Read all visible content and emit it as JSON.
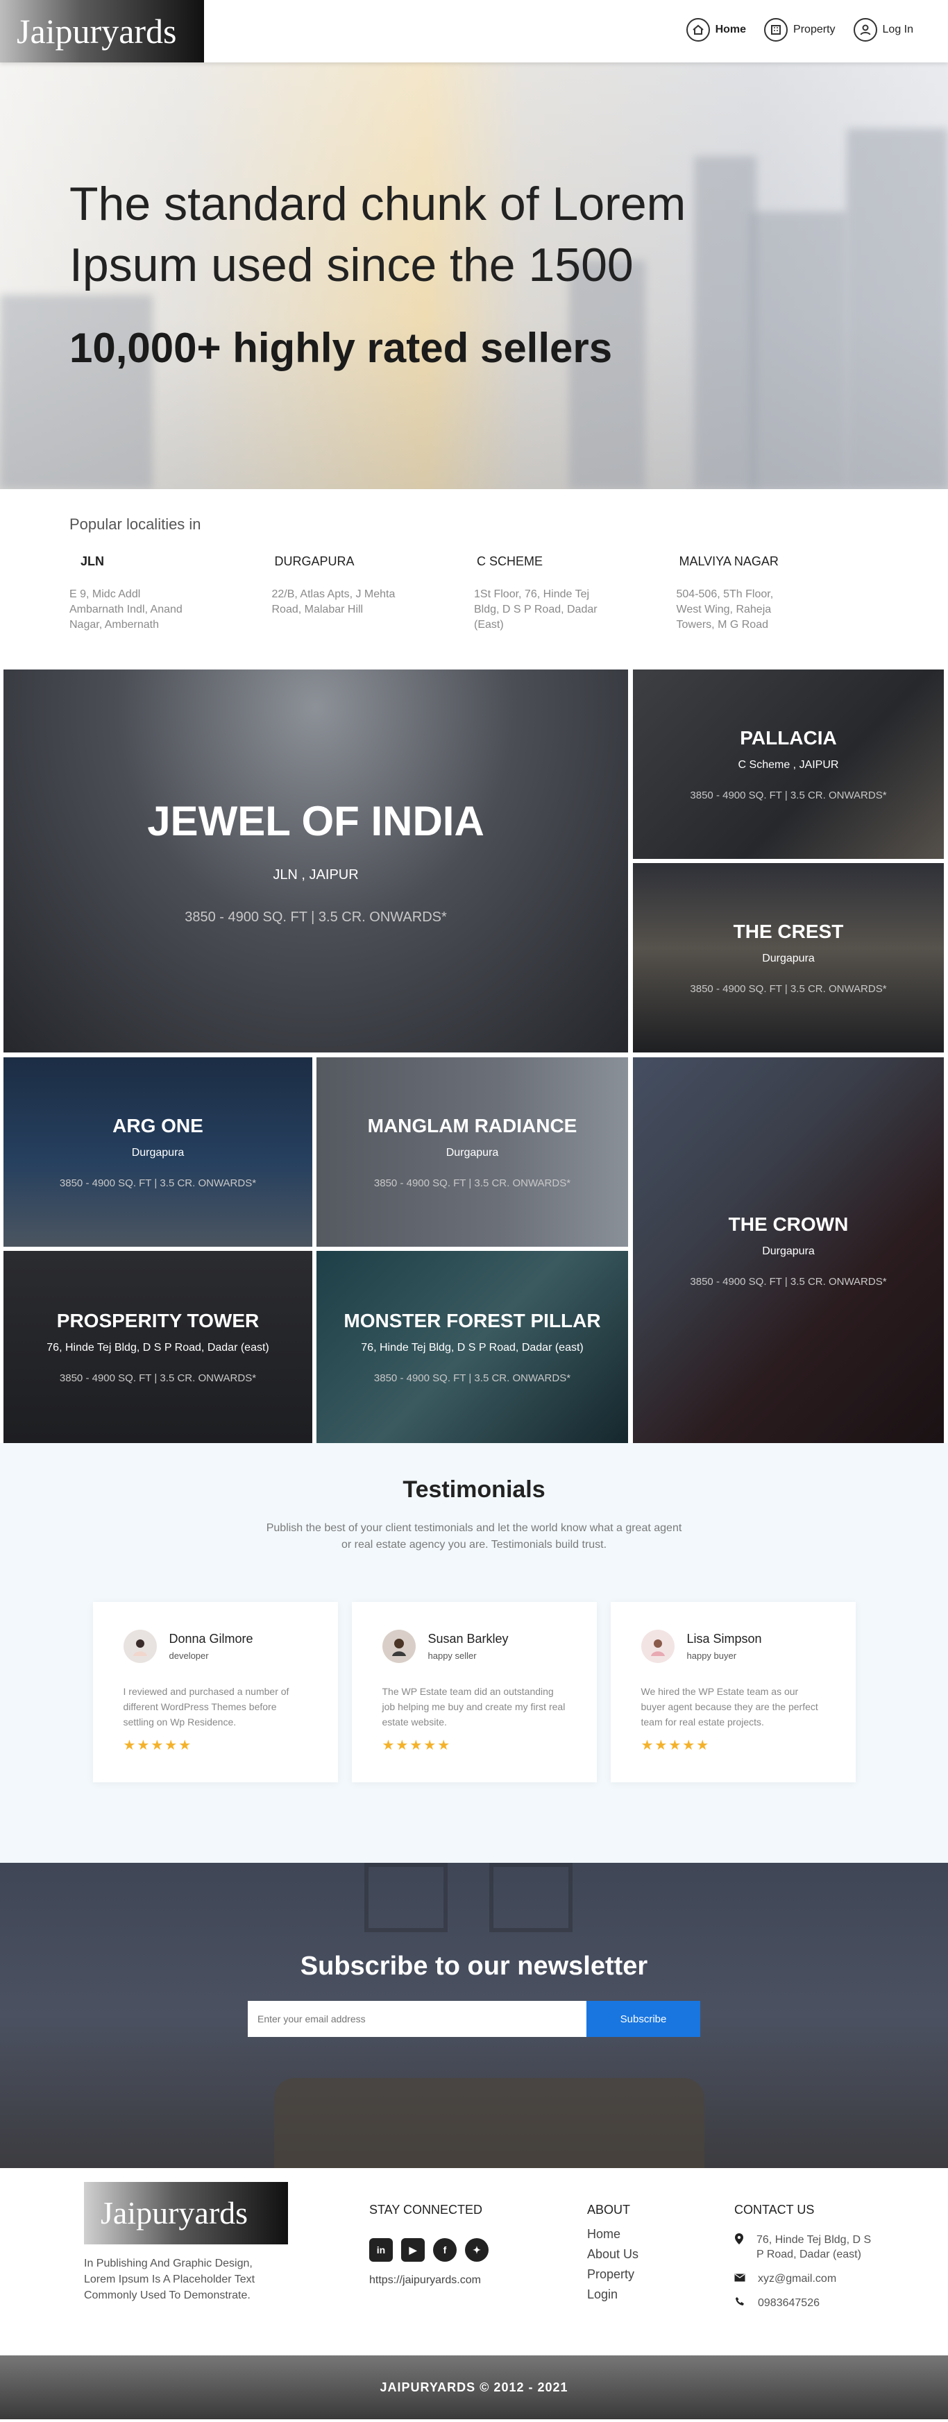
{
  "header": {
    "logo": "Jaipuryards",
    "nav": [
      {
        "label": "Home",
        "icon": "home-icon"
      },
      {
        "label": "Property",
        "icon": "building-icon"
      },
      {
        "label": "Log In",
        "icon": "user-icon"
      }
    ]
  },
  "hero": {
    "title": "The standard chunk of Lorem Ipsum used since the 1500",
    "subtitle": "10,000+ highly rated sellers"
  },
  "localities": {
    "heading": "Popular localities in",
    "items": [
      {
        "name": "JLN",
        "address": "E 9, Midc Addl Ambarnath Indl, Anand Nagar, Ambernath"
      },
      {
        "name": "DURGAPURA",
        "address": "22/B, Atlas Apts, J Mehta Road, Malabar Hill"
      },
      {
        "name": "C SCHEME",
        "address": "1St Floor, 76, Hinde Tej Bldg, D S P Road, Dadar (East)"
      },
      {
        "name": "MALVIYA NAGAR",
        "address": "504-506, 5Th Floor, West Wing, Raheja Towers, M G Road"
      }
    ]
  },
  "properties": [
    {
      "name": "JEWEL OF INDIA",
      "location": "JLN , JAIPUR",
      "area": "3850 - 4900 SQ. FT | 3.5 CR. ONWARDS*"
    },
    {
      "name": "PALLACIA",
      "location": "C Scheme , JAIPUR",
      "area": "3850 - 4900 SQ. FT | 3.5 CR. ONWARDS*"
    },
    {
      "name": "THE CREST",
      "location": "Durgapura",
      "area": "3850 - 4900 SQ. FT | 3.5 CR. ONWARDS*"
    },
    {
      "name": "ARG ONE",
      "location": "Durgapura",
      "area": "3850 - 4900 SQ. FT | 3.5 CR. ONWARDS*"
    },
    {
      "name": "MANGLAM RADIANCE",
      "location": "Durgapura",
      "area": "3850 - 4900 SQ. FT | 3.5 CR. ONWARDS*"
    },
    {
      "name": "THE CROWN",
      "location": "Durgapura",
      "area": "3850 - 4900 SQ. FT | 3.5 CR. ONWARDS*"
    },
    {
      "name": "PROSPERITY TOWER",
      "location": "76, Hinde Tej Bldg, D S P Road, Dadar (east)",
      "area": "3850 - 4900 SQ. FT | 3.5 CR. ONWARDS*"
    },
    {
      "name": "MONSTER FOREST PILLAR",
      "location": "76, Hinde Tej Bldg, D S P Road, Dadar (east)",
      "area": "3850 - 4900 SQ. FT | 3.5 CR. ONWARDS*"
    }
  ],
  "testimonials": {
    "title": "Testimonials",
    "lead": "Publish the best of your client testimonials and let the world know what a great agent or real estate agency you are. Testimonials build trust.",
    "items": [
      {
        "name": "Donna Gilmore",
        "role": "developer",
        "text": "I reviewed and purchased a number of different WordPress Themes before settling on Wp Residence.",
        "stars": "★★★★★",
        "rating": 5
      },
      {
        "name": "Susan Barkley",
        "role": "happy seller",
        "text": "The WP Estate team did an outstanding job helping me buy and create my first real estate website.",
        "stars": "★★★★★",
        "rating": 5
      },
      {
        "name": "Lisa Simpson",
        "role": "happy buyer",
        "text": "We hired the WP Estate team as our buyer agent because they are the perfect team for real estate projects.",
        "stars": "★★★★★",
        "rating": 5
      }
    ]
  },
  "newsletter": {
    "title": "Subscribe to our newsletter",
    "placeholder": "Enter your email address",
    "button": "Subscribe"
  },
  "footer": {
    "logo": "Jaipuryards",
    "description": "In Publishing And Graphic Design, Lorem Ipsum Is A Placeholder Text Commonly Used To Demonstrate.",
    "stay_connected": "STAY CONNECTED",
    "url": "https://jaipuryards.com",
    "about_heading": "ABOUT",
    "about_links": [
      "Home",
      "About Us",
      "Property",
      "Login"
    ],
    "contact_heading": "CONTACT US",
    "address": "76, Hinde Tej Bldg, D S P Road, Dadar (east)",
    "email": "xyz@gmail.com",
    "phone": "0983647526",
    "copyright": "JAIPURYARDS © 2012 - 2021"
  },
  "colors": {
    "accent": "#1976e0",
    "star": "#f4b22a"
  }
}
